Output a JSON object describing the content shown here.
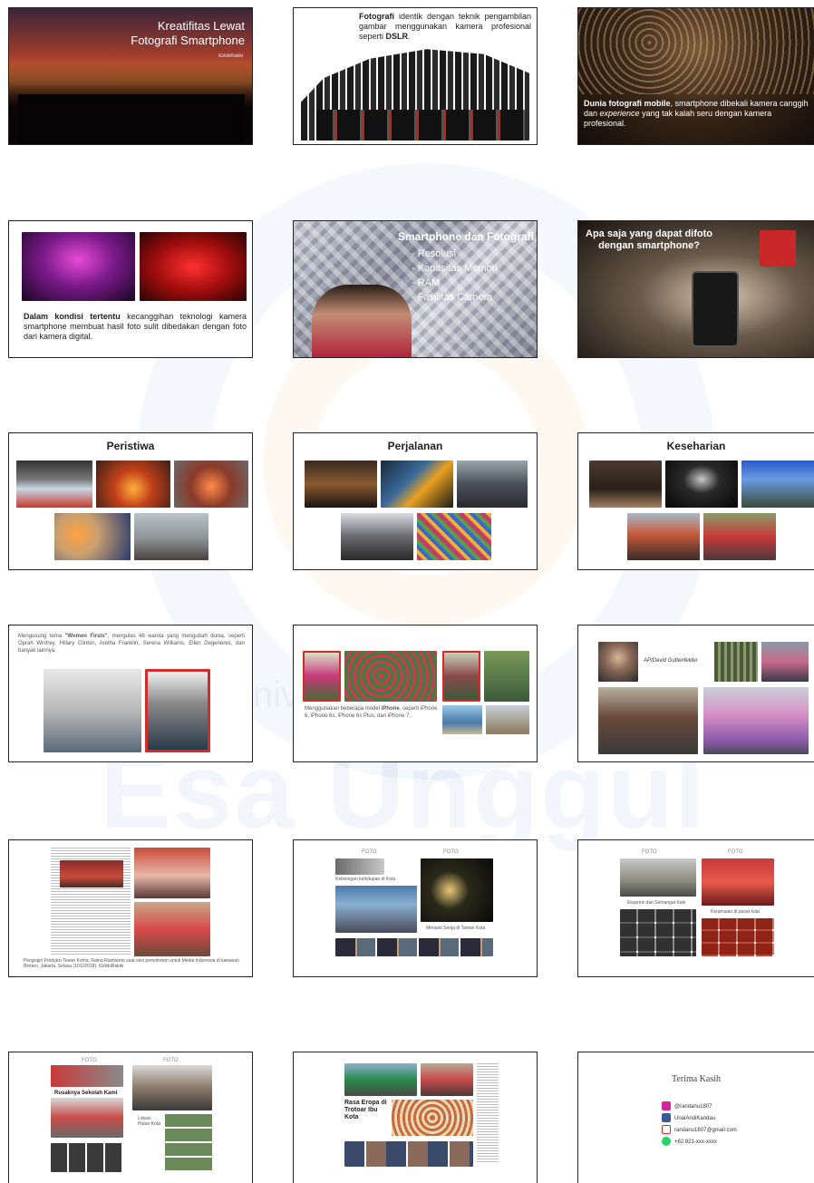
{
  "slides": {
    "s1": {
      "title": "Kreatifitas Lewat\nFotografi Smartphone",
      "credit": "IG/kikiRakiki"
    },
    "s2": {
      "bold1": "Fotografi",
      "text1": " identik dengan teknik pengambilan gambar menggunakan kamera profesional seperti ",
      "bold2": "DSLR",
      "text2": "."
    },
    "s3": {
      "bold": "Dunia fotografi mobile",
      "text1": ", smartphone dibekali kamera canggih dan ",
      "italic": "experience",
      "text2": " yang tak kalah seru dengan kamera profesional."
    },
    "s4": {
      "bold": "Dalam kondisi tertentu",
      "text": " kecanggihan teknologi kamera smartphone membuat hasil foto sulit dibedakan dengan foto dari kamera digital."
    },
    "s5": {
      "title": "Smartphone dan Fotografi",
      "items": [
        "- Resolusi",
        "- Kapasitas Memori",
        "- RAM",
        "- Fasilitas Camera"
      ]
    },
    "s6": {
      "title": "Apa saja yang dapat difoto dengan smartphone?"
    },
    "s7": {
      "title": "Peristiwa"
    },
    "s8": {
      "title": "Perjalanan"
    },
    "s9": {
      "title": "Keseharian"
    },
    "s10": {
      "text_a": "Mengusung tema ",
      "bold": "\"Women Firsts\"",
      "text_b": ", mengulas 46 wanita yang mengubah dunia, seperti Oprah Winfrey, Hillary Clinton, Aretha Franklin, Serena Williams, Ellen Degeneres, dan banyak lainnya."
    },
    "s11": {
      "text_a": "Menggunakan beberapa model ",
      "bold": "iPhone",
      "text_b": ", seperti iPhone 6, iPhone 6s, iPhone 6s Plus, dan iPhone 7."
    },
    "s12": {
      "credit": "AP/David Guttenfelder"
    },
    "s13": {
      "caption": "Pengrajin Produksi Teater Koma, Ratna Riantiarno saat sesi pemotretan untuk Media Indonesia di kawasan Bintaro, Jakarta, Selasa (10/1/2018). IG/kikiRakiki"
    },
    "s14": {
      "masthead_a": "FOTO",
      "masthead_b": "FOTO",
      "heading_a": "Kebisingan kehidupan di Kota",
      "heading_b": "Menanti Senja di Taman Kota"
    },
    "s15": {
      "masthead_a": "FOTO",
      "masthead_b": "FOTO",
      "heading_a": "Ekspresi dan Semangat Kaki",
      "heading_b": "Keramaian di pusat kota"
    },
    "s16": {
      "masthead_a": "FOTO",
      "masthead_b": "FOTO",
      "heading": "Rusaknya Sekolah Kami",
      "sub": "Lokasi Hutan Kota"
    },
    "s17": {
      "heading": "Rasa Eropa di Trotoar Ibu Kota"
    },
    "s18": {
      "title": "Terima Kasih",
      "contacts": [
        {
          "icon": "instagram-icon",
          "label": "@randanu1807",
          "color": "#d6249f"
        },
        {
          "icon": "facebook-icon",
          "label": "UnaiAndiKandau",
          "color": "#3b5998"
        },
        {
          "icon": "gmail-icon",
          "label": "randanu1807@gmail.com",
          "color": "#d93025"
        },
        {
          "icon": "whatsapp-icon",
          "label": "+62 821-xxx-xxxx",
          "color": "#25d366"
        }
      ]
    }
  },
  "colors": {
    "accent_red": "#d42a2a",
    "watermark_blue": "#4678c8",
    "watermark_orange": "#f0963c"
  },
  "watermark": {
    "line1": "Universitas",
    "line2": "Esa Unggul"
  }
}
